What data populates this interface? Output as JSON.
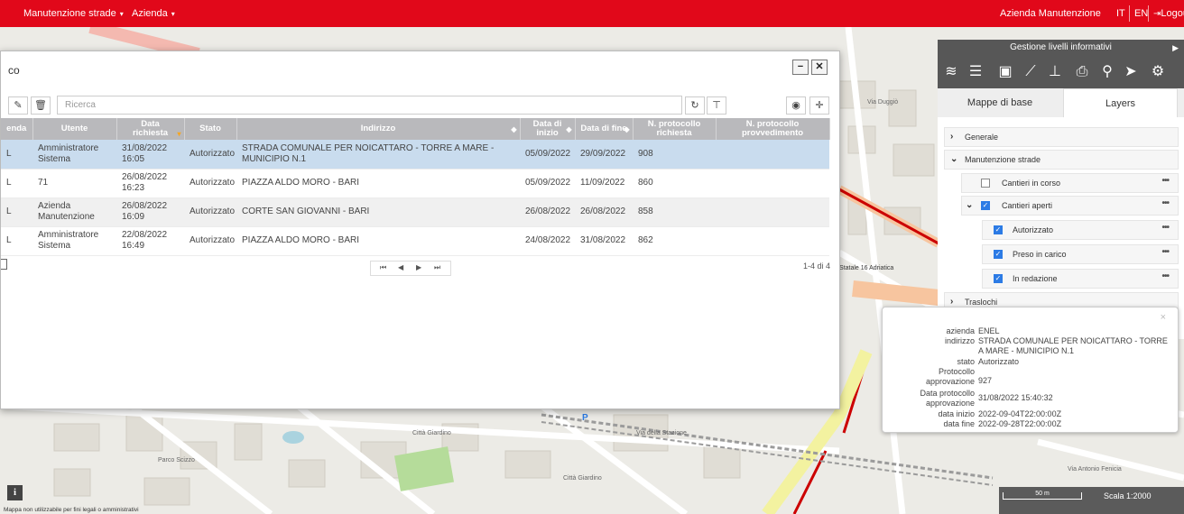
{
  "colors": {
    "brand": "#e1081a",
    "header_gray": "#b9b9bc",
    "selected_row": "#c9dcee",
    "check_blue": "#2c7be5",
    "panel_dark": "#575757"
  },
  "topbar": {
    "menu1": "Manutenzione strade",
    "menu2": "Azienda",
    "user": "Azienda Manutenzione",
    "lang_it": "IT",
    "lang_en": "EN",
    "logout": "Logout"
  },
  "dialog": {
    "title": "co",
    "minimize": "−",
    "close": "✕",
    "search_placeholder": "Ricerca",
    "columns": [
      "enda",
      "Utente",
      "Data richiesta",
      "Stato",
      "Indirizzo",
      "Data di inizio",
      "Data di fine",
      "N. protocollo richiesta",
      "N. protocollo provvedimento"
    ],
    "rows": [
      {
        "c0": "L",
        "utente": "Amministratore Sistema",
        "data_richiesta": "31/08/2022 16:05",
        "stato": "Autorizzato",
        "indirizzo": "STRADA COMUNALE PER NOICATTARO - TORRE A MARE - MUNICIPIO N.1",
        "data_inizio": "05/09/2022",
        "data_fine": "29/09/2022",
        "prot_richiesta": "908",
        "prot_provv": ""
      },
      {
        "c0": "L",
        "utente": "71",
        "data_richiesta": "26/08/2022 16:23",
        "stato": "Autorizzato",
        "indirizzo": "PIAZZA ALDO MORO - BARI",
        "data_inizio": "05/09/2022",
        "data_fine": "11/09/2022",
        "prot_richiesta": "860",
        "prot_provv": ""
      },
      {
        "c0": "L",
        "utente": "Azienda Manutenzione",
        "data_richiesta": "26/08/2022 16:09",
        "stato": "Autorizzato",
        "indirizzo": "CORTE SAN GIOVANNI - BARI",
        "data_inizio": "26/08/2022",
        "data_fine": "26/08/2022",
        "prot_richiesta": "858",
        "prot_provv": ""
      },
      {
        "c0": "L",
        "utente": "Amministratore Sistema",
        "data_richiesta": "22/08/2022 16:49",
        "stato": "Autorizzato",
        "indirizzo": "PIAZZA ALDO MORO - BARI",
        "data_inizio": "24/08/2022",
        "data_fine": "31/08/2022",
        "prot_richiesta": "862",
        "prot_provv": ""
      }
    ],
    "page_info": "1-4 di 4"
  },
  "panel": {
    "title": "Gestione livelli informativi",
    "tab_base": "Mappe di base",
    "tab_layers": "Layers",
    "groups": {
      "generale": "Generale",
      "manutenzione": "Manutenzione strade",
      "cantieri_corso": "Cantieri in corso",
      "cantieri_aperti": "Cantieri aperti",
      "autorizzato": "Autorizzato",
      "preso": "Preso in carico",
      "redazione": "In redazione",
      "traslochi": "Traslochi"
    },
    "dots": "•••"
  },
  "popup": {
    "close": "×",
    "azienda_k": "azienda",
    "azienda_v": "ENEL",
    "indirizzo_k": "indirizzo",
    "indirizzo_v": "STRADA COMUNALE PER NOICATTARO - TORRE A MARE - MUNICIPIO N.1",
    "stato_k": "stato",
    "stato_v": "Autorizzato",
    "prot_k": "Protocollo approvazione",
    "prot_v": "927",
    "dprot_k": "Data protocollo approvazione",
    "dprot_v": "31/08/2022 15:40:32",
    "dinizio_k": "data inizio",
    "dinizio_v": "2022-09-04T22:00:00Z",
    "dfine_k": "data fine",
    "dfine_v": "2022-09-28T22:00:00Z"
  },
  "map": {
    "labels": [
      "Città Giardino",
      "Parco Scizzo",
      "Città Giardino",
      "Via della Stazione",
      "Statale 16 Adriatica",
      "Via Antonio Fenicia",
      "Via Duggiò",
      "P"
    ],
    "scale_bar": "50 m",
    "scale_text": "Scala 1:2000",
    "info": "i",
    "disclaimer": "Mappa non utilizzabile per fini legali o amministrativi"
  }
}
